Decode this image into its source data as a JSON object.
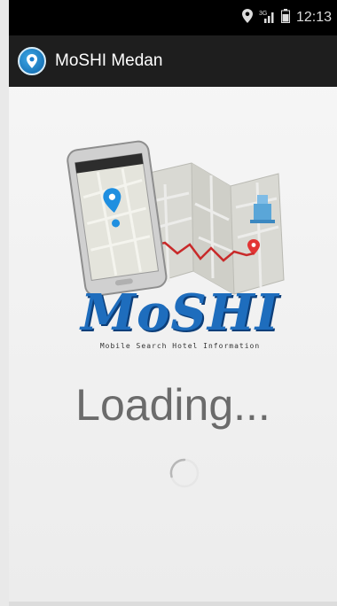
{
  "status_bar": {
    "time": "12:13",
    "icons": [
      "location-icon",
      "signal-icon",
      "battery-icon"
    ]
  },
  "action_bar": {
    "title": "MoSHI Medan",
    "app_icon": "moshi-app-icon"
  },
  "splash": {
    "brand": "MoSHI",
    "brand_subtitle": "Mobile Search Hotel Information",
    "loading_text": "Loading...",
    "spinner_icon": "loading-spinner-icon"
  },
  "colors": {
    "brand_blue": "#1e6dbd",
    "status_bar_bg": "#000000",
    "action_bar_bg": "#1e1e1e",
    "route_red": "#d62b2b",
    "pin_blue": "#1f8fe0"
  }
}
